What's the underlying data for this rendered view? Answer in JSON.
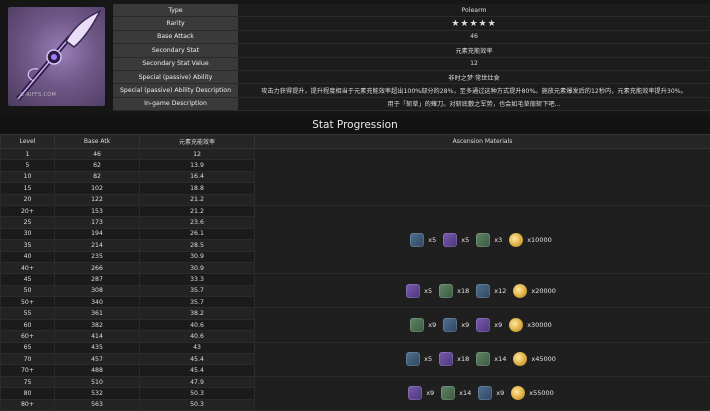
{
  "info": {
    "watermark": "G-RIFFS.COM",
    "rows": [
      {
        "key": "Type",
        "value": "Polearm"
      },
      {
        "key": "Rarity",
        "value": "★★★★★"
      },
      {
        "key": "Base Attack",
        "value": "46"
      },
      {
        "key": "Secondary Stat",
        "value": "元素充能效率"
      },
      {
        "key": "Secondary Stat Value",
        "value": "12"
      },
      {
        "key": "Special (passive) Ability",
        "value": "非时之梦·常世灶食"
      },
      {
        "key": "Special (passive) Ability Description",
        "value": "攻击力获得提升，提升程度相当于元素充能效率超出100%部分的28%，至多通过这种方式提升80%。施放元素爆发后的12秒内，元素充能效率提升30%。"
      },
      {
        "key": "In-game Description",
        "value": "用于「斩草」的薙刀。对斩底敷之军势，也会如毛草般斩下吧..."
      }
    ]
  },
  "stats": {
    "title": "Stat Progression",
    "headers": [
      "Level",
      "Base Atk",
      "元素充能效率",
      "Ascension Materials"
    ],
    "rows": [
      [
        "1",
        "46",
        "12"
      ],
      [
        "5",
        "62",
        "13.9"
      ],
      [
        "10",
        "82",
        "16.4"
      ],
      [
        "15",
        "102",
        "18.8"
      ],
      [
        "20",
        "122",
        "21.2"
      ],
      [
        "20+",
        "153",
        "21.2"
      ],
      [
        "25",
        "173",
        "23.6"
      ],
      [
        "30",
        "194",
        "26.1"
      ],
      [
        "35",
        "214",
        "28.5"
      ],
      [
        "40",
        "235",
        "30.9"
      ],
      [
        "40+",
        "266",
        "30.9"
      ],
      [
        "45",
        "287",
        "33.3"
      ],
      [
        "50",
        "308",
        "35.7"
      ],
      [
        "50+",
        "340",
        "35.7"
      ],
      [
        "55",
        "361",
        "38.2"
      ],
      [
        "60",
        "382",
        "40.6"
      ],
      [
        "60+",
        "414",
        "40.6"
      ],
      [
        "65",
        "435",
        "43"
      ],
      [
        "70",
        "457",
        "45.4"
      ],
      [
        "70+",
        "488",
        "45.4"
      ],
      [
        "75",
        "510",
        "47.9"
      ],
      [
        "80",
        "532",
        "50.3"
      ],
      [
        "80+",
        "563",
        "50.3"
      ]
    ],
    "materials": [
      {
        "items": [
          {
            "icon": "domain-material-icon",
            "count": "x5"
          },
          {
            "icon": "elite-drop-icon",
            "count": "x5"
          },
          {
            "icon": "common-drop-icon",
            "count": "x3"
          },
          {
            "icon": "mora-icon",
            "count": "x10000"
          }
        ]
      },
      {
        "items": [
          {
            "icon": "domain-material-icon",
            "count": "x5"
          },
          {
            "icon": "elite-drop-icon",
            "count": "x18"
          },
          {
            "icon": "common-drop-icon",
            "count": "x12"
          },
          {
            "icon": "mora-icon",
            "count": "x20000"
          }
        ]
      },
      {
        "items": [
          {
            "icon": "domain-material-icon",
            "count": "x9"
          },
          {
            "icon": "elite-drop-icon",
            "count": "x9"
          },
          {
            "icon": "common-drop-icon",
            "count": "x9"
          },
          {
            "icon": "mora-icon",
            "count": "x30000"
          }
        ]
      },
      {
        "items": [
          {
            "icon": "domain-material-icon",
            "count": "x5"
          },
          {
            "icon": "elite-drop-icon",
            "count": "x18"
          },
          {
            "icon": "common-drop-icon",
            "count": "x14"
          },
          {
            "icon": "mora-icon",
            "count": "x45000"
          }
        ]
      },
      {
        "items": [
          {
            "icon": "domain-material-icon",
            "count": "x9"
          },
          {
            "icon": "elite-drop-icon",
            "count": "x14"
          },
          {
            "icon": "common-drop-icon",
            "count": "x9"
          },
          {
            "icon": "mora-icon",
            "count": "x55000"
          }
        ]
      }
    ]
  }
}
